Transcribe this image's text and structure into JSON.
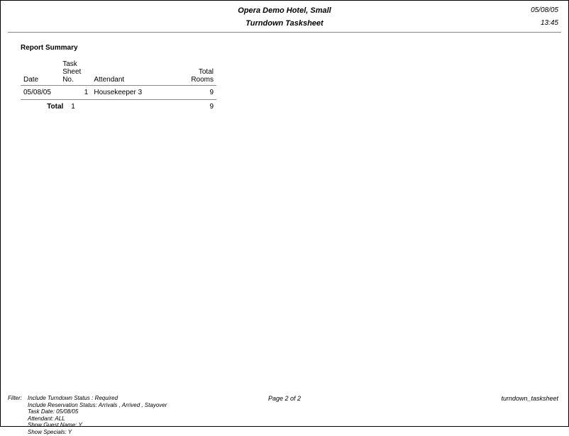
{
  "header": {
    "hotel_name": "Opera Demo Hotel, Small",
    "report_title": "Turndown Tasksheet",
    "date": "05/08/05",
    "time": "13:45"
  },
  "summary": {
    "heading": "Report Summary",
    "columns": {
      "date": "Date",
      "tasksheet_no_l1": "Task Sheet",
      "tasksheet_no_l2": "No.",
      "attendant": "Attendant",
      "total_rooms_l1": "Total",
      "total_rooms_l2": "Rooms"
    },
    "rows": [
      {
        "date": "05/08/05",
        "tasksheet_no": "1",
        "attendant": "Housekeeper 3",
        "total_rooms": "9"
      }
    ],
    "total": {
      "label": "Total",
      "tasksheet_no": "1",
      "total_rooms": "9"
    }
  },
  "footer": {
    "filter_label": "Filter:",
    "filter_lines": [
      "Include Turndown Status : Required",
      "Include Reservation Status:  Arrivals ,  Arrived ,  Stayover",
      "Task Date:      05/08/05",
      "Attendant:       ALL",
      "Show Guest Name:      Y",
      "Show Specials:        Y"
    ],
    "page": "Page 2 of 2",
    "report_id": "turndown_tasksheet"
  }
}
